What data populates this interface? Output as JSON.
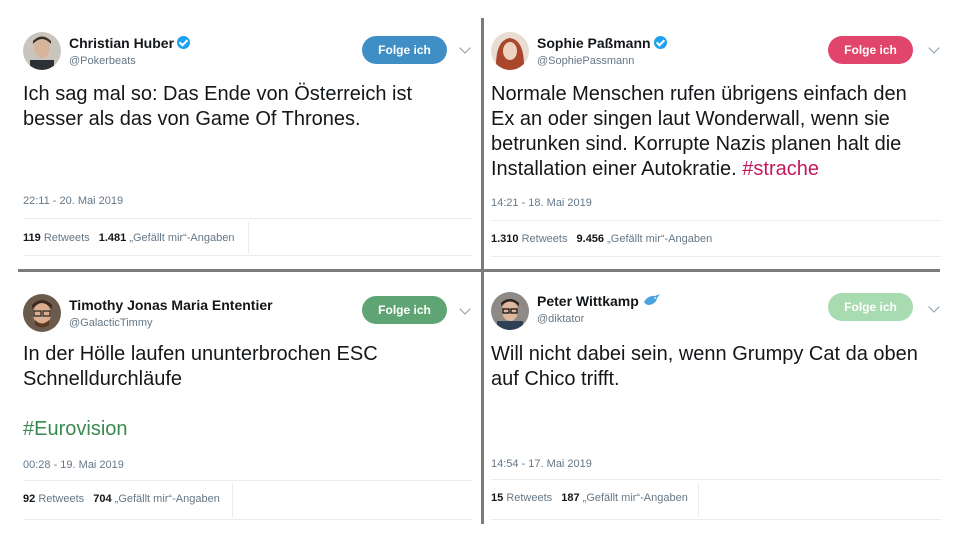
{
  "tweets": [
    {
      "name": "Christian Huber",
      "handle": "@Pokerbeats",
      "follow_label": "Folge ich",
      "follow_color": "#3f8fc6",
      "text": "Ich sag mal so: Das Ende von Österreich ist besser als das von Game Of Thrones.",
      "timestamp": "22:11 - 20. Mai 2019",
      "retweets": "119",
      "retweets_label": "Retweets",
      "likes": "1.481",
      "likes_label": "„Gefällt mir“-Angaben",
      "verified": true
    },
    {
      "name": "Sophie Paßmann",
      "handle": "@SophiePassmann",
      "follow_label": "Folge ich",
      "follow_color": "#e1456b",
      "text": "Normale Menschen rufen übrigens einfach den Ex an oder singen laut Wonderwall, wenn sie betrunken sind. Korrupte Nazis planen halt die Installation einer Autokratie.",
      "hashtag": "#strache",
      "timestamp": "14:21 - 18. Mai 2019",
      "retweets": "1.310",
      "retweets_label": "Retweets",
      "likes": "9.456",
      "likes_label": "„Gefällt mir“-Angaben",
      "verified": true
    },
    {
      "name": "Timothy Jonas Maria Ententier",
      "handle": "@GalacticTimmy",
      "follow_label": "Folge ich",
      "follow_color": "#5fa574",
      "text": "In der Hölle laufen ununterbrochen ESC Schnelldurchläufe",
      "hashtag": "#Eurovision",
      "timestamp": "00:28 - 19. Mai 2019",
      "retweets": "92",
      "retweets_label": "Retweets",
      "likes": "704",
      "likes_label": "„Gefällt mir“-Angaben",
      "verified": false
    },
    {
      "name": "Peter Wittkamp",
      "handle": "@diktator",
      "follow_label": "Folge ich",
      "follow_color": "#a9dbb1",
      "text": "Will nicht dabei sein, wenn Grumpy Cat da oben auf Chico trifft.",
      "timestamp": "14:54 - 17. Mai 2019",
      "retweets": "15",
      "retweets_label": "Retweets",
      "likes": "187",
      "likes_label": "„Gefällt mir“-Angaben",
      "verified": false
    }
  ]
}
